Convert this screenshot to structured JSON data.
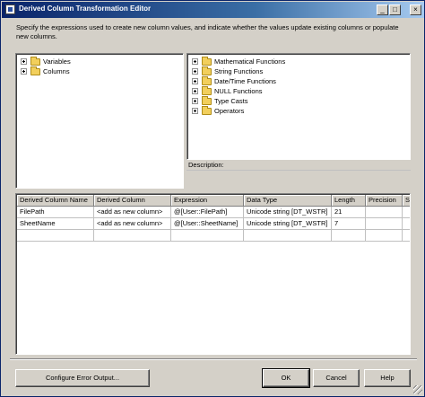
{
  "window": {
    "title": "Derived Column Transformation Editor",
    "minimize_glyph": "_",
    "maximize_glyph": "□",
    "close_glyph": "×"
  },
  "instructions": "Specify the expressions used to create new column values, and indicate whether the values update existing columns or populate new columns.",
  "left_tree": [
    {
      "label": "Variables"
    },
    {
      "label": "Columns"
    }
  ],
  "right_tree": [
    {
      "label": "Mathematical Functions"
    },
    {
      "label": "String Functions"
    },
    {
      "label": "Date/Time Functions"
    },
    {
      "label": "NULL Functions"
    },
    {
      "label": "Type Casts"
    },
    {
      "label": "Operators"
    }
  ],
  "description_label": "Description:",
  "grid": {
    "headers": [
      "Derived Column Name",
      "Derived Column",
      "Expression",
      "Data Type",
      "Length",
      "Precision",
      "S"
    ],
    "rows": [
      [
        "FilePath",
        "<add as new column>",
        "@[User::FilePath]",
        "Unicode string [DT_WSTR]",
        "21",
        "",
        ""
      ],
      [
        "SheetName",
        "<add as new column>",
        "@[User::SheetName]",
        "Unicode string [DT_WSTR]",
        "7",
        "",
        ""
      ]
    ]
  },
  "buttons": {
    "configure": "Configure Error Output...",
    "ok": "OK",
    "cancel": "Cancel",
    "help": "Help"
  }
}
